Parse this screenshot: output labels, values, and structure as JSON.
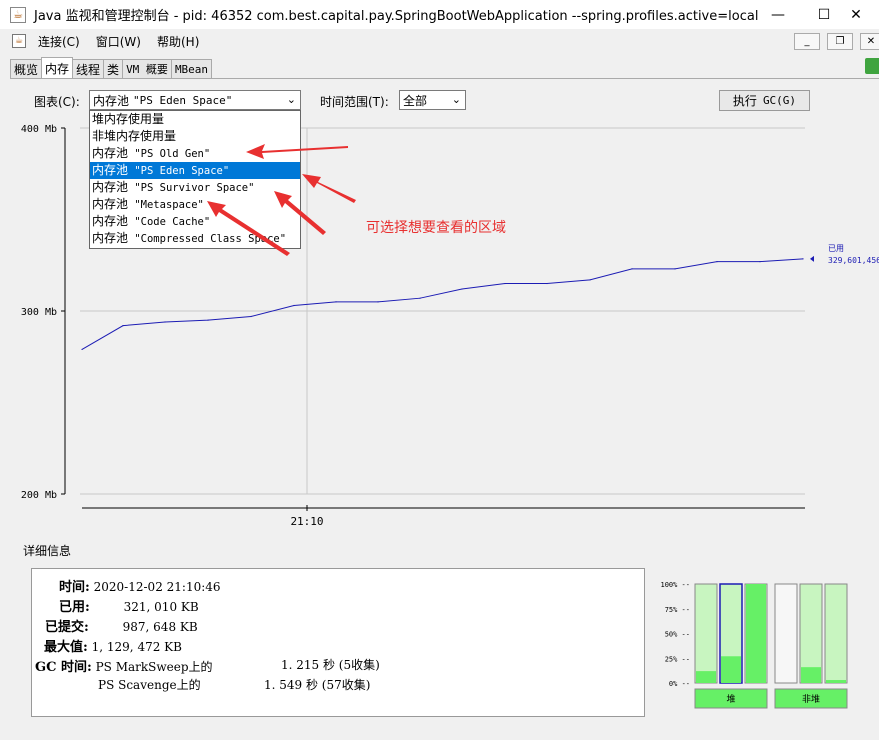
{
  "window": {
    "title": "Java 监视和管理控制台 - pid: 46352 com.best.capital.pay.SpringBootWebApplication --spring.profiles.active=local",
    "minimize": "—",
    "maximize": "☐",
    "close": "✕"
  },
  "menu": {
    "items": [
      "连接(C)",
      "窗口(W)",
      "帮助(H)"
    ]
  },
  "tabs": [
    "概览",
    "内存",
    "线程",
    "类",
    "VM 概要",
    "MBean"
  ],
  "active_tab": "内存",
  "controls": {
    "chart_label": "图表(C):",
    "chart_value_prefix": "内存池",
    "chart_value_name": "\"PS Eden Space\"",
    "time_label": "时间范围(T):",
    "time_value": "全部",
    "gc_button_prefix": "执行",
    "gc_button_key": "GC(G)"
  },
  "dropdown": {
    "items": [
      {
        "prefix": "堆内存使用量",
        "name": ""
      },
      {
        "prefix": "非堆内存使用量",
        "name": ""
      },
      {
        "prefix": "内存池",
        "name": " \"PS Old Gen\""
      },
      {
        "prefix": "内存池",
        "name": " \"PS Eden Space\""
      },
      {
        "prefix": "内存池",
        "name": " \"PS Survivor Space\""
      },
      {
        "prefix": "内存池",
        "name": " \"Metaspace\""
      },
      {
        "prefix": "内存池",
        "name": " \"Code Cache\""
      },
      {
        "prefix": "内存池",
        "name": " \"Compressed Class Space\""
      }
    ],
    "selected_index": 3
  },
  "annotation": "可选择想要查看的区域",
  "chart_data": {
    "type": "line",
    "title": "",
    "xlabel": "",
    "ylabel": "",
    "y_ticks": [
      "400 Mb",
      "300 Mb",
      "200 Mb"
    ],
    "ylim": [
      200,
      400
    ],
    "x_ticks": [
      "21:10"
    ],
    "series": [
      {
        "name": "已用",
        "x": [
          0,
          1,
          2,
          3,
          4,
          5,
          6,
          7,
          8,
          9,
          10,
          11,
          12,
          13,
          14,
          15,
          16,
          17
        ],
        "values": [
          279,
          292,
          294,
          295,
          297,
          303,
          305,
          305,
          307,
          312,
          315,
          315,
          317,
          323,
          323,
          327,
          327,
          328.5
        ]
      }
    ],
    "legend_label": "已用",
    "legend_value": "329,601,456",
    "colors": {
      "line": "#1c1cb4",
      "grid": "#c8c8c8"
    }
  },
  "details": {
    "title": "详细信息",
    "rows": [
      {
        "label": "时间:",
        "value": "2020-12-02 21:10:46"
      },
      {
        "label": "已用:",
        "value": "321, 010 KB"
      },
      {
        "label": "已提交:",
        "value": "987, 648 KB"
      },
      {
        "label": "最大值:",
        "value": "1, 129, 472 KB"
      }
    ],
    "gc_label": "GC 时间:",
    "gc_rows": [
      {
        "name": "PS MarkSweep上的",
        "time": "1. 215 秒 (5收集)"
      },
      {
        "name": "PS Scavenge上的",
        "time": "1. 549 秒 (57收集)"
      }
    ]
  },
  "usage_bars": {
    "ticks": [
      "100% --",
      "75% --",
      "50% --",
      "25% --",
      "0% --"
    ],
    "heap_label": "堆",
    "nonheap_label": "非堆",
    "heap": [
      {
        "committed": 1.0,
        "used": 0.12
      },
      {
        "committed": 1.0,
        "used": 0.27,
        "selected": true
      },
      {
        "committed": 1.0,
        "used": 1.0
      }
    ],
    "nonheap": [
      {
        "committed": 0.0,
        "used": 0.0
      },
      {
        "committed": 1.0,
        "used": 0.16
      },
      {
        "committed": 1.0,
        "used": 0.03
      }
    ]
  }
}
